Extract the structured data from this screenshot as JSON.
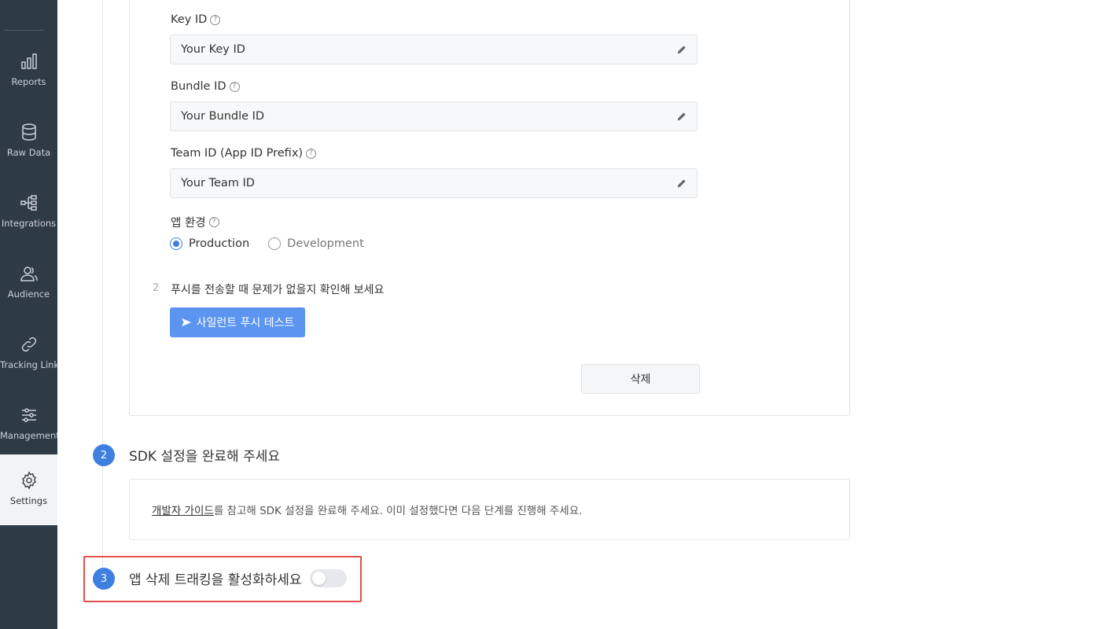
{
  "sidebar": {
    "items": [
      {
        "label": "Reports",
        "icon": "bar-chart-icon"
      },
      {
        "label": "Raw Data",
        "icon": "database-icon"
      },
      {
        "label": "Integrations",
        "icon": "integrations-icon"
      },
      {
        "label": "Audience",
        "icon": "users-icon"
      },
      {
        "label": "Tracking Link",
        "icon": "link-icon"
      },
      {
        "label": "Management",
        "icon": "sliders-icon"
      },
      {
        "label": "Settings",
        "icon": "gear-icon"
      }
    ],
    "active": "Settings"
  },
  "form": {
    "key_id_label": "Key ID",
    "key_id_value": "Your Key ID",
    "bundle_id_label": "Bundle ID",
    "bundle_id_value": "Your Bundle ID",
    "team_id_label": "Team ID (App ID Prefix)",
    "team_id_value": "Your Team ID",
    "env_label": "앱 환경",
    "env_options": [
      "Production",
      "Development"
    ],
    "env_selected": "Production",
    "help_glyph": "?"
  },
  "push_step": {
    "number": "2",
    "text": "푸시를 전송할 때 문제가 없을지 확인해 보세요",
    "button_label": "사일런트 푸시 테스트"
  },
  "delete_label": "삭제",
  "sdk_section": {
    "number": "2",
    "title": "SDK 설정을 완료해 주세요",
    "link_text": "개발자 가이드",
    "body_text": "를 참고해 SDK 설정을 완료해 주세요. 이미 설정했다면 다음 단계를 진행해 주세요."
  },
  "uninstall_section": {
    "number": "3",
    "title": "앱 삭제 트래킹을 활성화하세요",
    "toggle_on": false
  },
  "colors": {
    "sidebar_bg": "#2f3a47",
    "accent": "#3f7fe0",
    "button_blue": "#5b95ef",
    "highlight_red": "#e0504d"
  }
}
